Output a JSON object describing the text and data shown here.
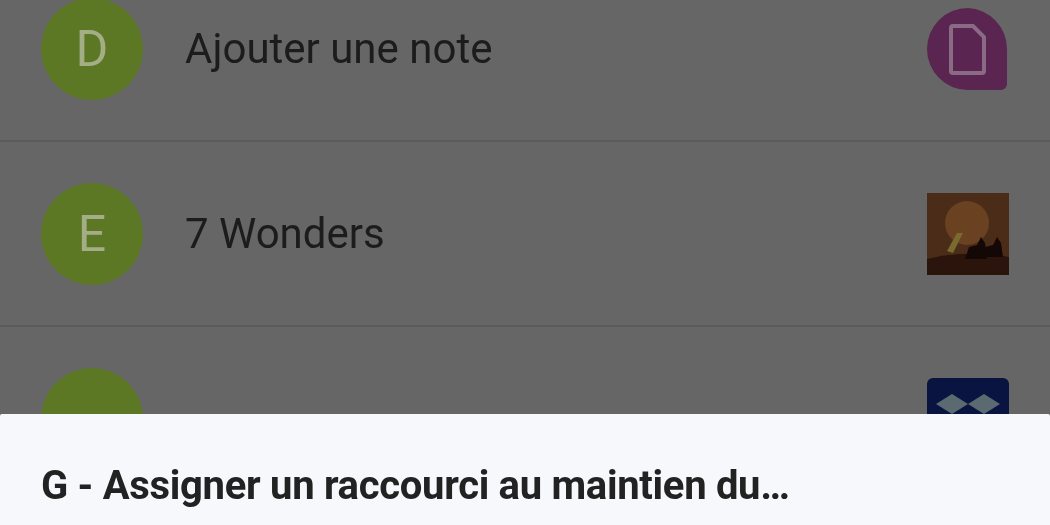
{
  "shortcuts": [
    {
      "letter": "D",
      "title": "Ajouter une note",
      "kind": "note"
    },
    {
      "letter": "E",
      "title": "7 Wonders",
      "kind": "picture"
    },
    {
      "kind": "box"
    }
  ],
  "sheet": {
    "title": "G - Assigner un raccourci au maintien du…"
  }
}
